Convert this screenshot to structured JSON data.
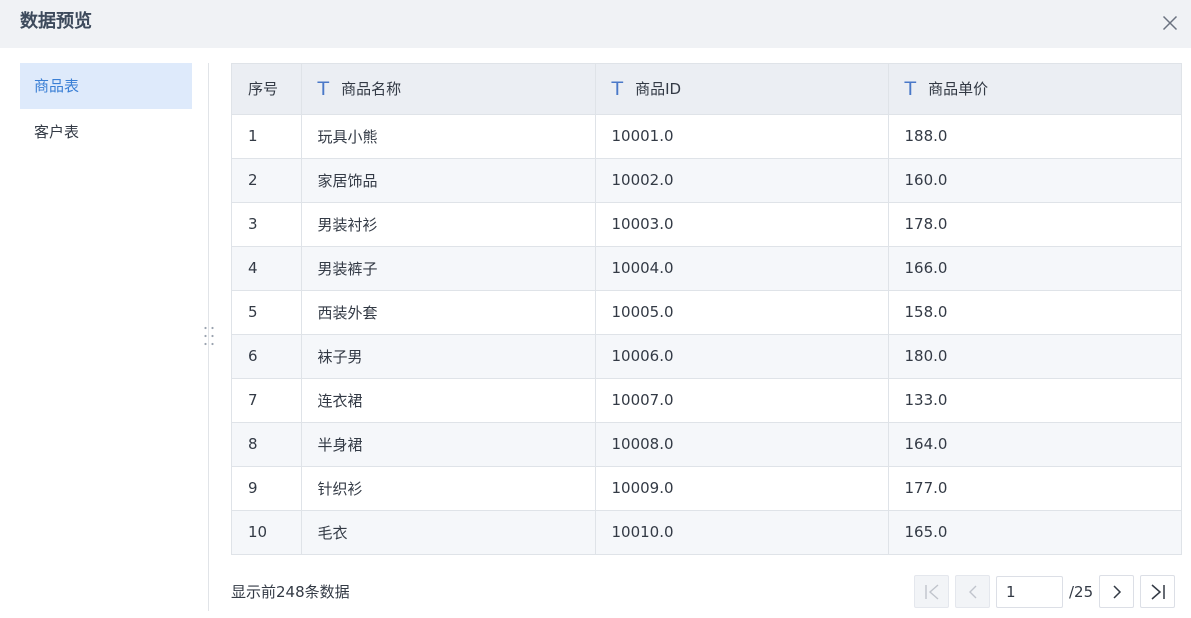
{
  "dialog": {
    "title": "数据预览",
    "close_icon": "close-icon"
  },
  "sidebar": {
    "items": [
      {
        "label": "商品表",
        "active": true
      },
      {
        "label": "客户表",
        "active": false
      }
    ]
  },
  "table": {
    "headers": {
      "index": "序号",
      "name": "商品名称",
      "id": "商品ID",
      "price": "商品单价"
    },
    "header_icon": "text-type-icon",
    "rows": [
      {
        "index": "1",
        "name": "玩具小熊",
        "id": "10001.0",
        "price": "188.0"
      },
      {
        "index": "2",
        "name": "家居饰品",
        "id": "10002.0",
        "price": "160.0"
      },
      {
        "index": "3",
        "name": "男装衬衫",
        "id": "10003.0",
        "price": "178.0"
      },
      {
        "index": "4",
        "name": "男装裤子",
        "id": "10004.0",
        "price": "166.0"
      },
      {
        "index": "5",
        "name": "西装外套",
        "id": "10005.0",
        "price": "158.0"
      },
      {
        "index": "6",
        "name": "袜子男",
        "id": "10006.0",
        "price": "180.0"
      },
      {
        "index": "7",
        "name": "连衣裙",
        "id": "10007.0",
        "price": "133.0"
      },
      {
        "index": "8",
        "name": "半身裙",
        "id": "10008.0",
        "price": "164.0"
      },
      {
        "index": "9",
        "name": "针织衫",
        "id": "10009.0",
        "price": "177.0"
      },
      {
        "index": "10",
        "name": "毛衣",
        "id": "10010.0",
        "price": "165.0"
      }
    ]
  },
  "footer": {
    "info": "显示前248条数据"
  },
  "pagination": {
    "current_page": "1",
    "total_label": "/25",
    "first_icon": "first-page-icon",
    "prev_icon": "chevron-left-icon",
    "next_icon": "chevron-right-icon",
    "last_icon": "last-page-icon"
  },
  "colors": {
    "accent": "#3a7fd5",
    "active_bg": "#deeafb",
    "header_bg": "#f0f2f5"
  }
}
